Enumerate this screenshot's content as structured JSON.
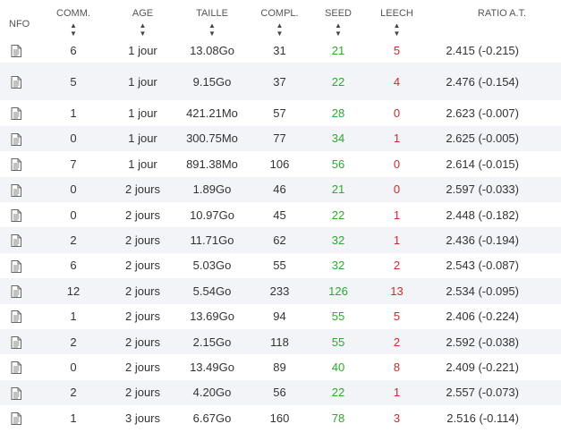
{
  "headers": {
    "nfo": "NFO",
    "comm": "COMM.",
    "age": "AGE",
    "taille": "TAILLE",
    "compl": "COMPL.",
    "seed": "SEED",
    "leech": "LEECH",
    "ratio": "RATIO A.T."
  },
  "sort_icon": "sort-icon",
  "nfo_icon": "document-icon",
  "colors": {
    "seed": "#2ea82e",
    "leech": "#d0292b",
    "row_alt": "#f2f4f7"
  },
  "rows": [
    {
      "comm": "6",
      "age": "1 jour",
      "taille": "13.08Go",
      "compl": "31",
      "seed": "21",
      "leech": "5",
      "ratio": "2.415 (-0.215)"
    },
    {
      "comm": "5",
      "age": "1 jour",
      "taille": "9.15Go",
      "compl": "37",
      "seed": "22",
      "leech": "4",
      "ratio": "2.476 (-0.154)"
    },
    {
      "comm": "1",
      "age": "1 jour",
      "taille": "421.21Mo",
      "compl": "57",
      "seed": "28",
      "leech": "0",
      "ratio": "2.623 (-0.007)"
    },
    {
      "comm": "0",
      "age": "1 jour",
      "taille": "300.75Mo",
      "compl": "77",
      "seed": "34",
      "leech": "1",
      "ratio": "2.625 (-0.005)"
    },
    {
      "comm": "7",
      "age": "1 jour",
      "taille": "891.38Mo",
      "compl": "106",
      "seed": "56",
      "leech": "0",
      "ratio": "2.614 (-0.015)"
    },
    {
      "comm": "0",
      "age": "2 jours",
      "taille": "1.89Go",
      "compl": "46",
      "seed": "21",
      "leech": "0",
      "ratio": "2.597 (-0.033)"
    },
    {
      "comm": "0",
      "age": "2 jours",
      "taille": "10.97Go",
      "compl": "45",
      "seed": "22",
      "leech": "1",
      "ratio": "2.448 (-0.182)"
    },
    {
      "comm": "2",
      "age": "2 jours",
      "taille": "11.71Go",
      "compl": "62",
      "seed": "32",
      "leech": "1",
      "ratio": "2.436 (-0.194)"
    },
    {
      "comm": "6",
      "age": "2 jours",
      "taille": "5.03Go",
      "compl": "55",
      "seed": "32",
      "leech": "2",
      "ratio": "2.543 (-0.087)"
    },
    {
      "comm": "12",
      "age": "2 jours",
      "taille": "5.54Go",
      "compl": "233",
      "seed": "126",
      "leech": "13",
      "ratio": "2.534 (-0.095)"
    },
    {
      "comm": "1",
      "age": "2 jours",
      "taille": "13.69Go",
      "compl": "94",
      "seed": "55",
      "leech": "5",
      "ratio": "2.406 (-0.224)"
    },
    {
      "comm": "2",
      "age": "2 jours",
      "taille": "2.15Go",
      "compl": "118",
      "seed": "55",
      "leech": "2",
      "ratio": "2.592 (-0.038)"
    },
    {
      "comm": "0",
      "age": "2 jours",
      "taille": "13.49Go",
      "compl": "89",
      "seed": "40",
      "leech": "8",
      "ratio": "2.409 (-0.221)"
    },
    {
      "comm": "2",
      "age": "2 jours",
      "taille": "4.20Go",
      "compl": "56",
      "seed": "22",
      "leech": "1",
      "ratio": "2.557 (-0.073)"
    },
    {
      "comm": "1",
      "age": "3 jours",
      "taille": "6.67Go",
      "compl": "160",
      "seed": "78",
      "leech": "3",
      "ratio": "2.516 (-0.114)"
    }
  ]
}
